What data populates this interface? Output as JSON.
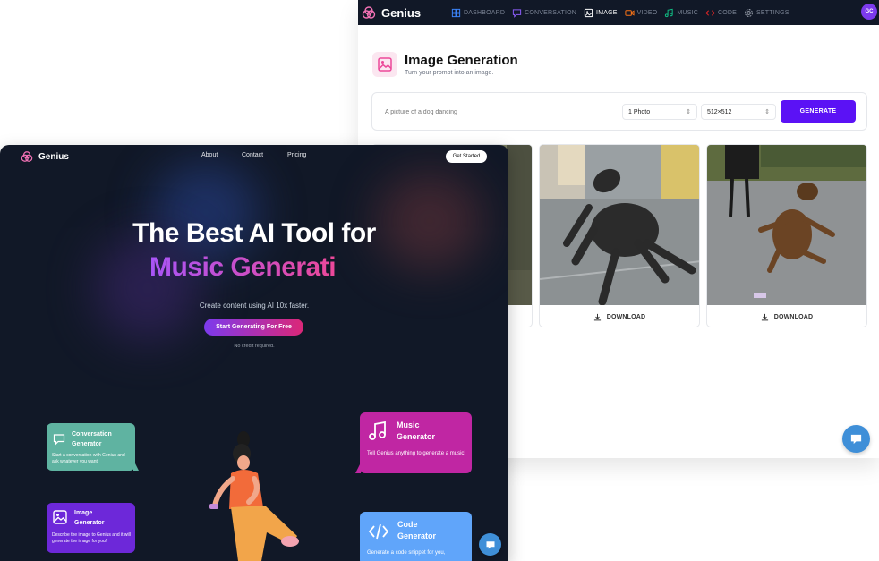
{
  "dashboard": {
    "brand": "Genius",
    "nav": [
      {
        "label": "DASHBOARD",
        "icon": "dashboard-icon",
        "color": "#3b82f6"
      },
      {
        "label": "CONVERSATION",
        "icon": "chat-icon",
        "color": "#8b5cf6"
      },
      {
        "label": "IMAGE",
        "icon": "image-icon",
        "color": "#ec4899"
      },
      {
        "label": "VIDEO",
        "icon": "video-icon",
        "color": "#f97316"
      },
      {
        "label": "MUSIC",
        "icon": "music-icon",
        "color": "#10b981"
      },
      {
        "label": "CODE",
        "icon": "code-icon",
        "color": "#dc2626"
      },
      {
        "label": "SETTINGS",
        "icon": "gear-icon",
        "color": "#9ca3af"
      }
    ],
    "active_nav": "IMAGE",
    "avatar": "GC",
    "title": "Image Generation",
    "subtitle": "Turn your prompt into an image.",
    "prompt_placeholder": "A picture of a dog dancing",
    "amount": "1 Photo",
    "resolution": "512×512",
    "generate_label": "GENERATE",
    "download_label": "DOWNLOAD",
    "accent": "#5b12f5"
  },
  "landing": {
    "brand": "Genius",
    "links": [
      "About",
      "Contact",
      "Pricing"
    ],
    "get_started": "Get Started",
    "headline": "The Best AI Tool for",
    "typed": "Music Generati",
    "subline": "Create content using AI 10x faster.",
    "cta": "Start Generating For Free",
    "note": "No credit required.",
    "cards": {
      "conversation": {
        "title": "Conversation\nGenerator",
        "desc": "Start a conversation with Genius and ask whatever you want!",
        "color": "#5fb3a1"
      },
      "image": {
        "title": "Image\nGenerator",
        "desc": "Describe the image to Genius and it will generate the image for you!",
        "color": "#6d28d9"
      },
      "music": {
        "title": "Music\nGenerator",
        "desc": "Tell Genius anything to generate a music!",
        "color": "#c026a3"
      },
      "code": {
        "title": "Code\nGenerator",
        "desc": "Generate a code snippet for you,",
        "color": "#60a5fa"
      }
    }
  }
}
